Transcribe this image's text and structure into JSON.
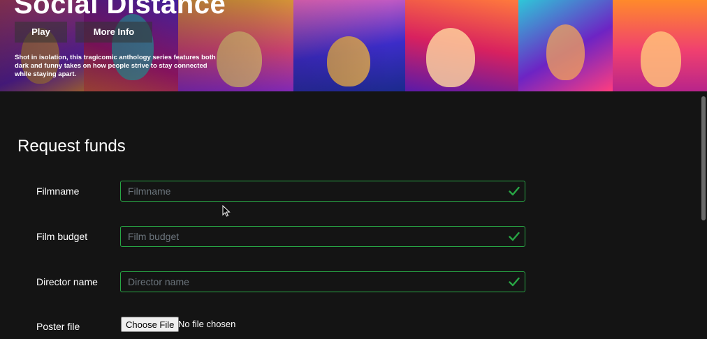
{
  "hero": {
    "title": "Social Distance",
    "play_label": "Play",
    "more_info_label": "More Info",
    "description": "Shot in isolation, this tragicomic anthology series features both dark and funny takes on how people strive to stay connected while staying apart."
  },
  "form": {
    "title": "Request funds",
    "accent_color": "#28a745",
    "fields": [
      {
        "label": "Filmname",
        "placeholder": "Filmname",
        "value": ""
      },
      {
        "label": "Film budget",
        "placeholder": "Film budget",
        "value": ""
      },
      {
        "label": "Director name",
        "placeholder": "Director name",
        "value": ""
      }
    ],
    "poster": {
      "label": "Poster file",
      "button_label": "Choose File",
      "status": "No file chosen"
    }
  },
  "icons": {
    "valid": "check-icon",
    "pointer": "mouse-cursor-icon"
  }
}
